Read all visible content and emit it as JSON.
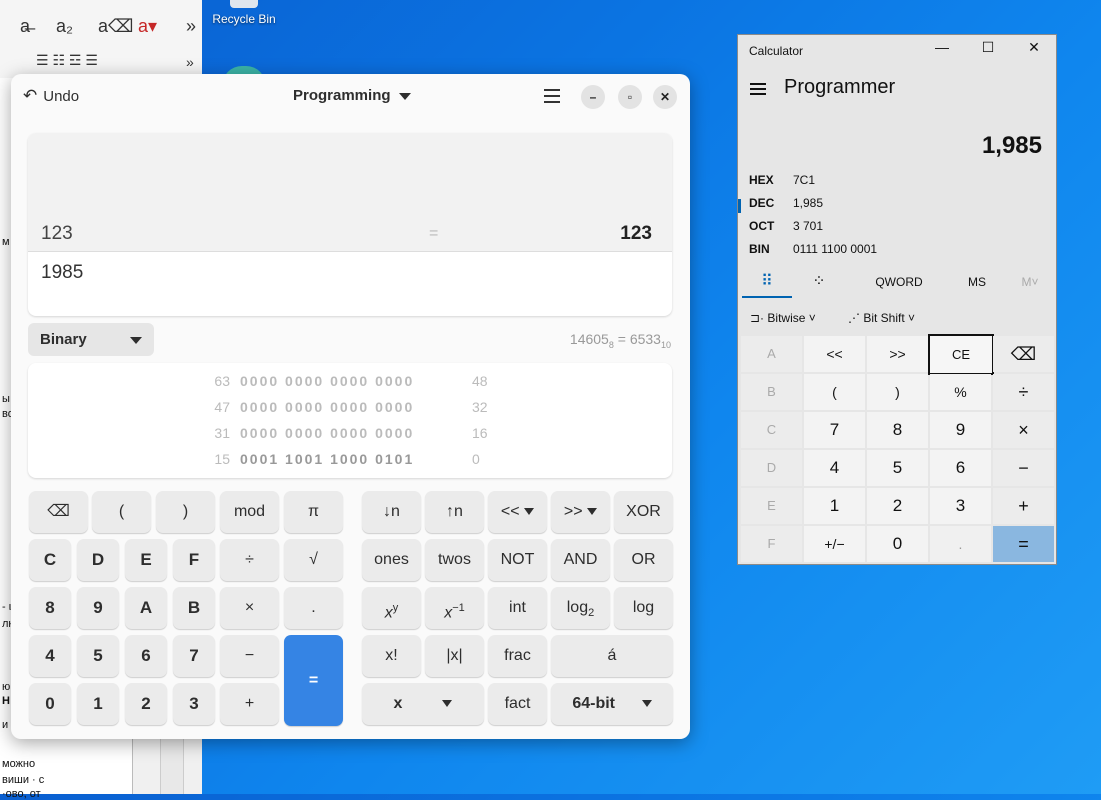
{
  "desktop": {
    "recycle_bin": "Recycle Bin"
  },
  "bg_app": {
    "snippets": [
      "м",
      "ы",
      "во",
      "- ι",
      "лн",
      "ю",
      "Н",
      "и",
      "можно",
      "виши · с",
      "·ово, от"
    ]
  },
  "gnome_calc": {
    "undo_label": "Undo",
    "mode_label": "Programming",
    "history": {
      "expression": "123",
      "equals": "=",
      "result": "123"
    },
    "input": "1985",
    "base_selector": "Binary",
    "conversion": {
      "left": "14605",
      "left_sub": "8",
      "eq": " = ",
      "right": "6533",
      "right_sub": "10"
    },
    "bit_rows": [
      {
        "lo": "63",
        "bits": "0000 0000 0000 0000",
        "hi": "48"
      },
      {
        "lo": "47",
        "bits": "0000 0000 0000 0000",
        "hi": "32"
      },
      {
        "lo": "31",
        "bits": "0000 0000 0000 0000",
        "hi": "16"
      },
      {
        "lo": "15",
        "bits": "0001 1001 1000 0101",
        "hi": "0"
      }
    ],
    "keys": {
      "backspace": "⌫",
      "lparen": "(",
      "rparen": ")",
      "mod": "mod",
      "pi": "π",
      "shift_down": "↓n",
      "shift_up": "↑n",
      "lshift": "<<",
      "rshift": ">>",
      "xor": "XOR",
      "c": "C",
      "d": "D",
      "e": "E",
      "f": "F",
      "divide": "÷",
      "sqrt": "√",
      "ones": "ones",
      "twos": "twos",
      "not": "NOT",
      "and": "AND",
      "or": "OR",
      "n8": "8",
      "n9": "9",
      "a": "A",
      "b": "B",
      "multiply": "×",
      "point": ".",
      "power_base": "x",
      "power_exp": "y",
      "inv_base": "x",
      "inv_exp": "−1",
      "int": "int",
      "log2_base": "log",
      "log2_sub": "2",
      "log": "log",
      "n4": "4",
      "n5": "5",
      "n6": "6",
      "n7": "7",
      "minus": "−",
      "equals": "=",
      "fact_sym": "x!",
      "abs": "|x|",
      "frac": "frac",
      "accent": "á",
      "n0": "0",
      "n1": "1",
      "n2": "2",
      "n3": "3",
      "plus": "+",
      "x_menu": "x",
      "fact": "fact",
      "wordsize": "64-bit"
    }
  },
  "win_calc": {
    "title": "Calculator",
    "controls": {
      "min": "—",
      "max": "☐",
      "close": "✕"
    },
    "mode": "Programmer",
    "value": "1,985",
    "radix": [
      {
        "name": "HEX",
        "value": "7C1"
      },
      {
        "name": "DEC",
        "value": "1,985"
      },
      {
        "name": "OCT",
        "value": "3 701"
      },
      {
        "name": "BIN",
        "value": "0111 1100 0001"
      }
    ],
    "tabs": {
      "keypad": "⠿",
      "bitpad": "⁘",
      "qword": "QWORD",
      "ms": "MS",
      "mdown": "M˅"
    },
    "ops": {
      "bitwise": "Bitwise",
      "bitshift": "Bit Shift"
    },
    "keys": {
      "a": "A",
      "lsh": "<<",
      "rsh": ">>",
      "ce": "CE",
      "back": "⌫",
      "b": "B",
      "lp": "(",
      "rp": ")",
      "pct": "%",
      "div": "÷",
      "c": "C",
      "n7": "7",
      "n8": "8",
      "n9": "9",
      "mul": "×",
      "d": "D",
      "n4": "4",
      "n5": "5",
      "n6": "6",
      "sub": "−",
      "e": "E",
      "n1": "1",
      "n2": "2",
      "n3": "3",
      "add": "+",
      "f": "F",
      "neg": "+/−",
      "n0": "0",
      "dot": ".",
      "eq": "="
    }
  }
}
